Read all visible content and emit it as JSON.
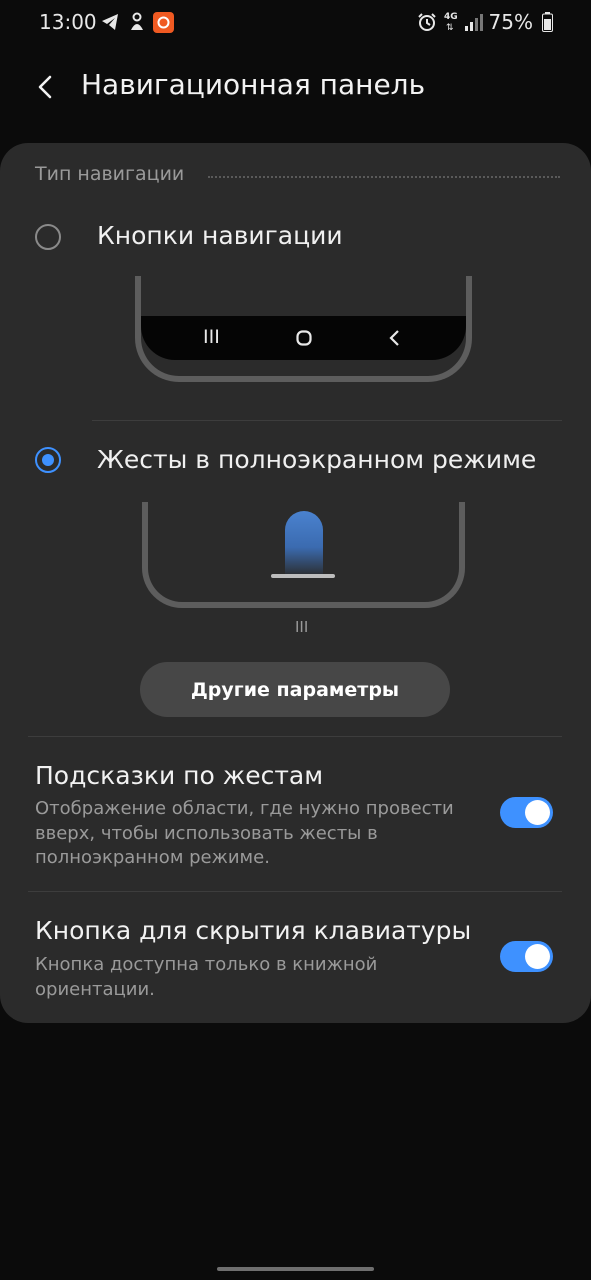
{
  "status_bar": {
    "time": "13:00",
    "network": "4G",
    "battery": "75%"
  },
  "header": {
    "title": "Навигационная панель"
  },
  "section": {
    "title": "Тип навигации"
  },
  "options": [
    {
      "label": "Кнопки навигации",
      "selected": false
    },
    {
      "label": "Жесты в полноэкранном режиме",
      "selected": true
    }
  ],
  "other_button": {
    "label": "Другие параметры"
  },
  "settings": [
    {
      "title": "Подсказки по жестам",
      "description": "Отображение области, где нужно провести вверх, чтобы использовать жесты в полноэкранном режиме.",
      "enabled": true
    },
    {
      "title": "Кнопка для скрытия клавиатуры",
      "description": "Кнопка доступна только в книжной ориентации.",
      "enabled": true
    }
  ],
  "colors": {
    "accent": "#3e91ff",
    "card": "#2b2b2b",
    "background": "#0b0b0b"
  }
}
